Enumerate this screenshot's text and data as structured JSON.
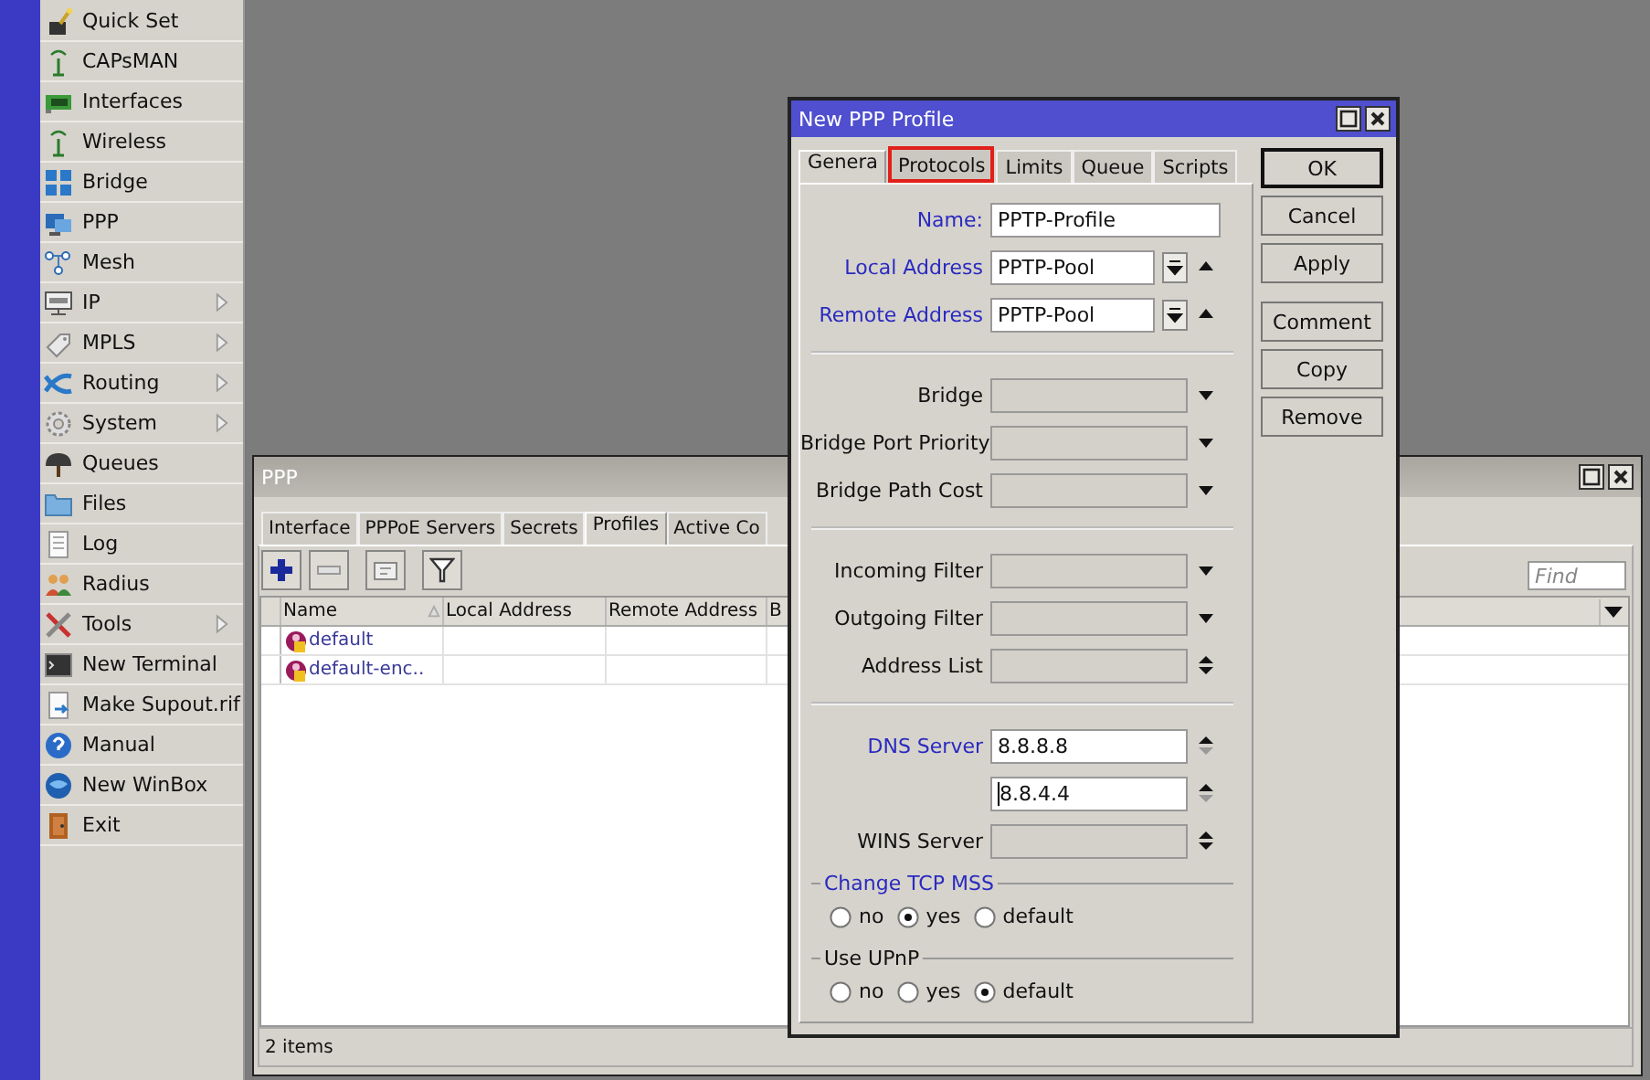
{
  "sidebar": {
    "items": [
      {
        "label": "Quick Set",
        "submenu": false
      },
      {
        "label": "CAPsMAN",
        "submenu": false
      },
      {
        "label": "Interfaces",
        "submenu": false
      },
      {
        "label": "Wireless",
        "submenu": false
      },
      {
        "label": "Bridge",
        "submenu": false
      },
      {
        "label": "PPP",
        "submenu": false
      },
      {
        "label": "Mesh",
        "submenu": false
      },
      {
        "label": "IP",
        "submenu": true
      },
      {
        "label": "MPLS",
        "submenu": true
      },
      {
        "label": "Routing",
        "submenu": true
      },
      {
        "label": "System",
        "submenu": true
      },
      {
        "label": "Queues",
        "submenu": false
      },
      {
        "label": "Files",
        "submenu": false
      },
      {
        "label": "Log",
        "submenu": false
      },
      {
        "label": "Radius",
        "submenu": false
      },
      {
        "label": "Tools",
        "submenu": true
      },
      {
        "label": "New Terminal",
        "submenu": false
      },
      {
        "label": "Make Supout.rif",
        "submenu": false
      },
      {
        "label": "Manual",
        "submenu": false
      },
      {
        "label": "New WinBox",
        "submenu": false
      },
      {
        "label": "Exit",
        "submenu": false
      }
    ]
  },
  "ppp_window": {
    "title": "PPP",
    "tabs": [
      {
        "label": "Interface",
        "selected": false
      },
      {
        "label": "PPPoE Servers",
        "selected": false
      },
      {
        "label": "Secrets",
        "selected": false
      },
      {
        "label": "Profiles",
        "selected": true
      },
      {
        "label": "Active Co",
        "selected": false
      }
    ],
    "find": {
      "placeholder": "Find"
    },
    "table": {
      "columns": [
        "Name",
        "Local Address",
        "Remote Address",
        "B"
      ],
      "rows": [
        {
          "name": "default"
        },
        {
          "name": "default-enc.."
        }
      ]
    },
    "status": "2 items"
  },
  "dialog": {
    "title": "New PPP Profile",
    "tabs": [
      {
        "label": "Genera",
        "selected": true,
        "highlighted": false
      },
      {
        "label": "Protocols",
        "selected": false,
        "highlighted": true
      },
      {
        "label": "Limits",
        "selected": false,
        "highlighted": false
      },
      {
        "label": "Queue",
        "selected": false,
        "highlighted": false
      },
      {
        "label": "Scripts",
        "selected": false,
        "highlighted": false
      }
    ],
    "sections": [
      {
        "fields": [
          {
            "kind": "text",
            "label": "Name:",
            "value": "PPTP-Profile",
            "set": true
          },
          {
            "kind": "pool",
            "label": "Local Address",
            "value": "PPTP-Pool",
            "set": true
          },
          {
            "kind": "pool",
            "label": "Remote Address",
            "value": "PPTP-Pool",
            "set": true
          }
        ]
      },
      {
        "fields": [
          {
            "kind": "select",
            "label": "Bridge",
            "set": false
          },
          {
            "kind": "select",
            "label": "Bridge Port Priority",
            "set": false
          },
          {
            "kind": "select",
            "label": "Bridge Path Cost",
            "set": false
          }
        ]
      },
      {
        "fields": [
          {
            "kind": "select",
            "label": "Incoming Filter",
            "set": false
          },
          {
            "kind": "select",
            "label": "Outgoing Filter",
            "set": false
          },
          {
            "kind": "list",
            "label": "Address List",
            "set": false
          }
        ]
      },
      {
        "fields": [
          {
            "kind": "list",
            "label": "DNS Server",
            "value": "8.8.8.8",
            "set": true
          },
          {
            "kind": "list",
            "value": "8.8.4.4",
            "set": true
          },
          {
            "kind": "list",
            "label": "WINS Server",
            "set": false
          }
        ]
      }
    ],
    "radio_groups": [
      {
        "title": "Change TCP MSS",
        "set": true,
        "options": [
          {
            "label": "no",
            "selected": false
          },
          {
            "label": "yes",
            "selected": true
          },
          {
            "label": "default",
            "selected": false
          }
        ]
      },
      {
        "title": "Use UPnP",
        "set": false,
        "options": [
          {
            "label": "no",
            "selected": false
          },
          {
            "label": "yes",
            "selected": false
          },
          {
            "label": "default",
            "selected": true
          }
        ]
      }
    ],
    "button_groups": [
      [
        {
          "label": "OK",
          "default": true
        },
        {
          "label": "Cancel",
          "default": false
        },
        {
          "label": "Apply",
          "default": false
        }
      ],
      [
        {
          "label": "Comment",
          "default": false
        },
        {
          "label": "Copy",
          "default": false
        },
        {
          "label": "Remove",
          "default": false
        }
      ]
    ]
  }
}
